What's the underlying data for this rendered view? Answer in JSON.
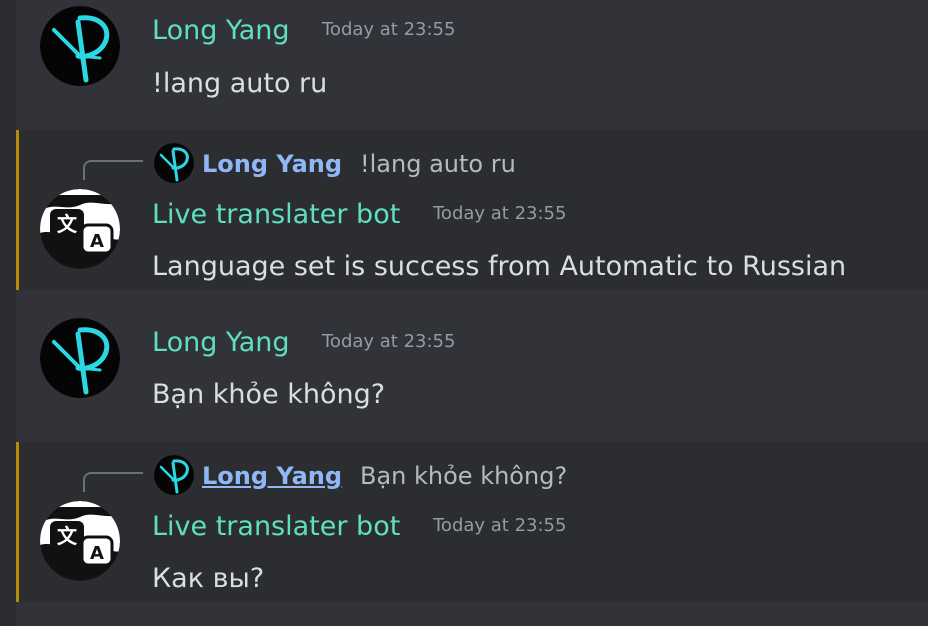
{
  "colors": {
    "background": "#313338",
    "highlight_background": "#2b2d31",
    "highlight_border": "#b88a0a",
    "username": "#5ee0c0",
    "reply_username": "#8fb7f5",
    "timestamp": "#949ba4",
    "message_text": "#dbdee1"
  },
  "messages": [
    {
      "author": "Long Yang",
      "timestamp": "Today at 23:55",
      "content": "!lang auto ru",
      "avatar_icon": "teal-p-logo-icon"
    },
    {
      "reply": {
        "author": "Long Yang",
        "content": "!lang auto ru"
      },
      "author": "Live translater bot",
      "timestamp": "Today at 23:55",
      "content": "Language set is success from Automatic to Russian",
      "avatar_icon": "translate-icon"
    },
    {
      "author": "Long Yang",
      "timestamp": "Today at 23:55",
      "content": "Bạn khỏe không?",
      "avatar_icon": "teal-p-logo-icon"
    },
    {
      "reply": {
        "author": "Long Yang",
        "content": "Bạn khỏe không?"
      },
      "author": "Live translater bot",
      "timestamp": "Today at 23:55",
      "content": "Как вы?",
      "avatar_icon": "translate-icon"
    }
  ]
}
